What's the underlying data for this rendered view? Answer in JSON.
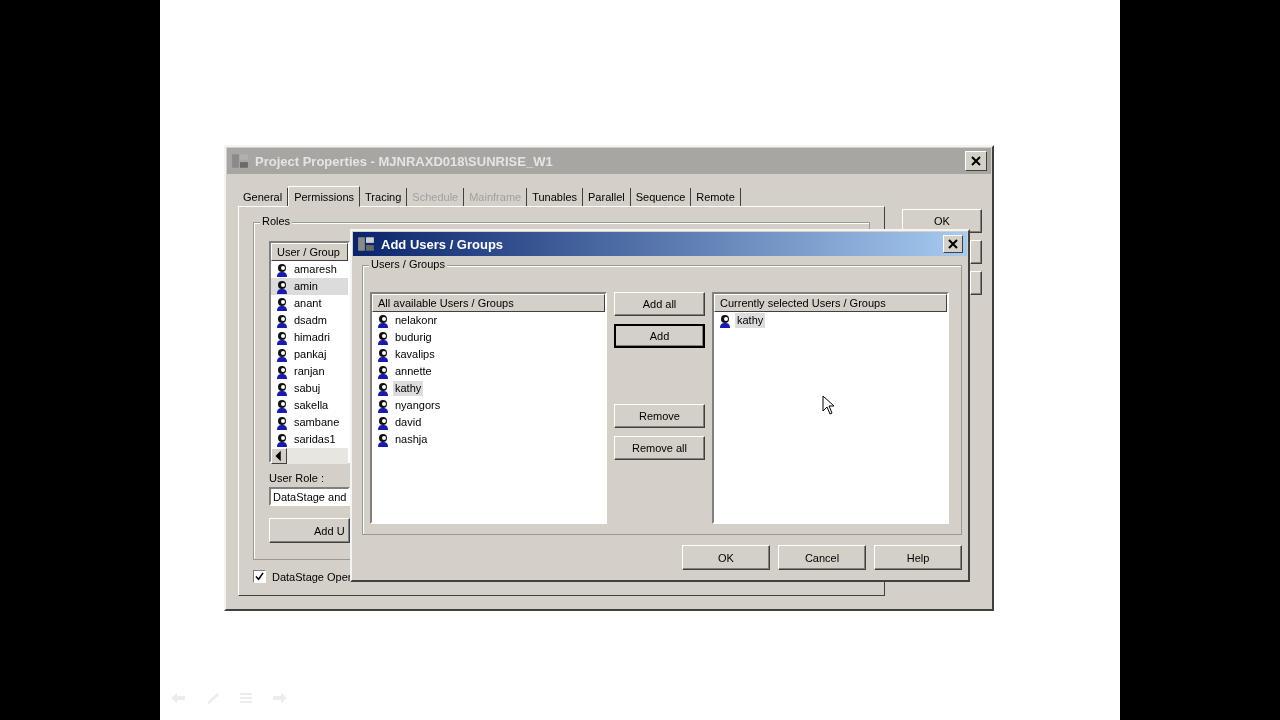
{
  "window": {
    "title": "Project Properties - MJNRAXD018\\SUNRISE_W1"
  },
  "tabs": [
    {
      "label": "General",
      "selected": false,
      "disabled": false
    },
    {
      "label": "Permissions",
      "selected": true,
      "disabled": false
    },
    {
      "label": "Tracing",
      "selected": false,
      "disabled": false
    },
    {
      "label": "Schedule",
      "selected": false,
      "disabled": true
    },
    {
      "label": "Mainframe",
      "selected": false,
      "disabled": true
    },
    {
      "label": "Tunables",
      "selected": false,
      "disabled": false
    },
    {
      "label": "Parallel",
      "selected": false,
      "disabled": false
    },
    {
      "label": "Sequence",
      "selected": false,
      "disabled": false
    },
    {
      "label": "Remote",
      "selected": false,
      "disabled": false
    }
  ],
  "roles": {
    "label": "Roles",
    "column": "User / Group",
    "users": [
      {
        "name": "amaresh",
        "selected": false
      },
      {
        "name": "amin",
        "selected": true
      },
      {
        "name": "anant",
        "selected": false
      },
      {
        "name": "dsadm",
        "selected": false
      },
      {
        "name": "himadri",
        "selected": false
      },
      {
        "name": "pankaj",
        "selected": false
      },
      {
        "name": "ranjan",
        "selected": false
      },
      {
        "name": "sabuj",
        "selected": false
      },
      {
        "name": "sakella",
        "selected": false
      },
      {
        "name": "sambane",
        "selected": false
      },
      {
        "name": "saridas1",
        "selected": false
      }
    ],
    "user_role_label": "User Role :",
    "user_role_value": "DataStage and",
    "add_button": "Add U",
    "checkbox": {
      "label": "DataStage Oper",
      "checked": true
    }
  },
  "side_buttons": [
    {
      "label": "OK"
    }
  ],
  "dialog": {
    "title": "Add Users / Groups",
    "group_label": "Users / Groups",
    "available": {
      "column": "All available Users / Groups",
      "items": [
        {
          "name": "nelakonr",
          "selected": false
        },
        {
          "name": "budurig",
          "selected": false
        },
        {
          "name": "kavalips",
          "selected": false
        },
        {
          "name": "annette",
          "selected": false
        },
        {
          "name": "kathy",
          "selected": true
        },
        {
          "name": "nyangors",
          "selected": false
        },
        {
          "name": "david",
          "selected": false
        },
        {
          "name": "nashja",
          "selected": false
        }
      ]
    },
    "add_actions": [
      {
        "label": "Add all",
        "default": false
      },
      {
        "label": "Add",
        "default": true
      }
    ],
    "remove_actions": [
      {
        "label": "Remove",
        "default": false
      },
      {
        "label": "Remove all",
        "default": false
      }
    ],
    "selected_list": {
      "column": "Currently selected Users / Groups",
      "items": [
        {
          "name": "kathy",
          "selected": true
        }
      ]
    },
    "buttons": [
      "OK",
      "Cancel",
      "Help"
    ]
  }
}
